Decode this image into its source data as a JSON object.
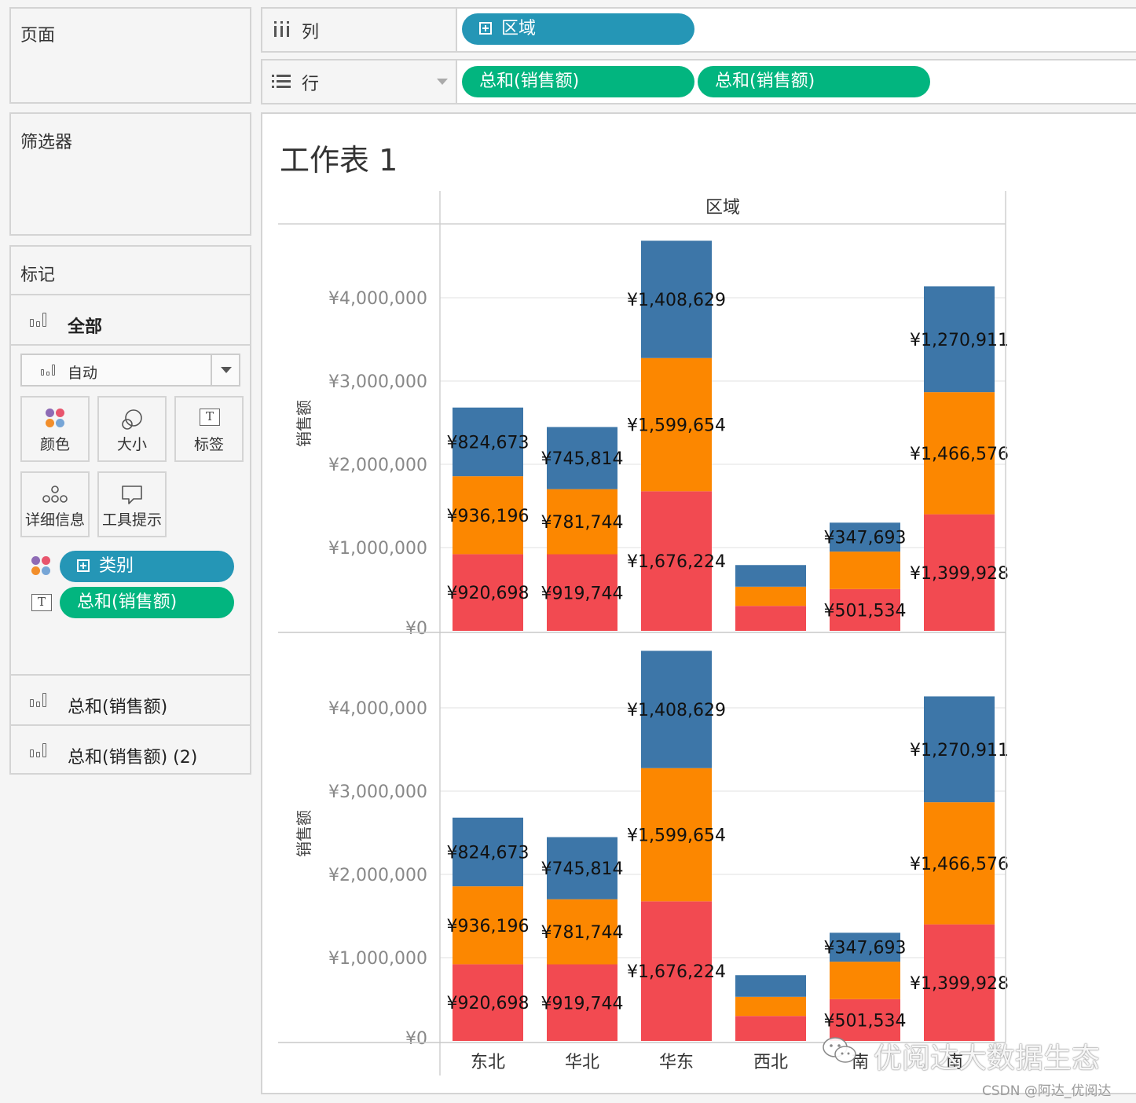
{
  "left_panels": {
    "pages_title": "页面",
    "filters_title": "筛选器",
    "marks": {
      "title": "标记",
      "all_label": "全部",
      "mark_type": "自动",
      "tiles": [
        "颜色",
        "大小",
        "标签",
        "详细信息",
        "工具提示"
      ],
      "fields": [
        "类别",
        "总和(销售额)"
      ],
      "measures": [
        "总和(销售额)",
        "总和(销售额) (2)"
      ]
    }
  },
  "shelves": {
    "columns_label": "列",
    "rows_label": "行",
    "columns_pills": [
      "区域"
    ],
    "rows_pills": [
      "总和(销售额)",
      "总和(销售额)"
    ]
  },
  "worksheet": {
    "title": "工作表 1",
    "column_header": "区域"
  },
  "watermark": {
    "text": "优阅达大数据生态",
    "credit": "CSDN @阿达_优阅达"
  },
  "colors": {
    "blue": "#3d76a8",
    "orange": "#fc8700",
    "red": "#f24a51",
    "pill_blue": "#2596b6",
    "pill_green": "#02b57f"
  },
  "chart_data": {
    "type": "bar",
    "stacked": true,
    "panes": 2,
    "ylabel": "销售额",
    "yticks": [
      "¥0",
      "¥1,000,000",
      "¥2,000,000",
      "¥3,000,000",
      "¥4,000,000"
    ],
    "ylim": [
      0,
      4850000
    ],
    "categories": [
      "东北",
      "华北",
      "华东",
      "西北",
      "西南",
      "中南"
    ],
    "visible_category_labels": [
      "东北",
      "华北",
      "华东",
      "西北",
      "南",
      "南"
    ],
    "series": [
      {
        "color": "red",
        "values": [
          920698,
          919744,
          1676224,
          300000,
          501534,
          1399928
        ]
      },
      {
        "color": "orange",
        "values": [
          936196,
          781744,
          1599654,
          230000,
          450000,
          1466576
        ]
      },
      {
        "color": "blue",
        "values": [
          824673,
          745814,
          1408629,
          260000,
          347693,
          1270911
        ]
      }
    ],
    "data_labels": [
      [
        "¥920,698",
        "¥936,196",
        "¥824,673"
      ],
      [
        "¥919,744",
        "¥781,744",
        "¥745,814"
      ],
      [
        "¥1,676,224",
        "¥1,599,654",
        "¥1,408,629"
      ],
      [
        "",
        "",
        ""
      ],
      [
        "¥501,534",
        "",
        "¥347,693"
      ],
      [
        "¥1,399,928",
        "¥1,466,576",
        "¥1,270,911"
      ]
    ]
  }
}
